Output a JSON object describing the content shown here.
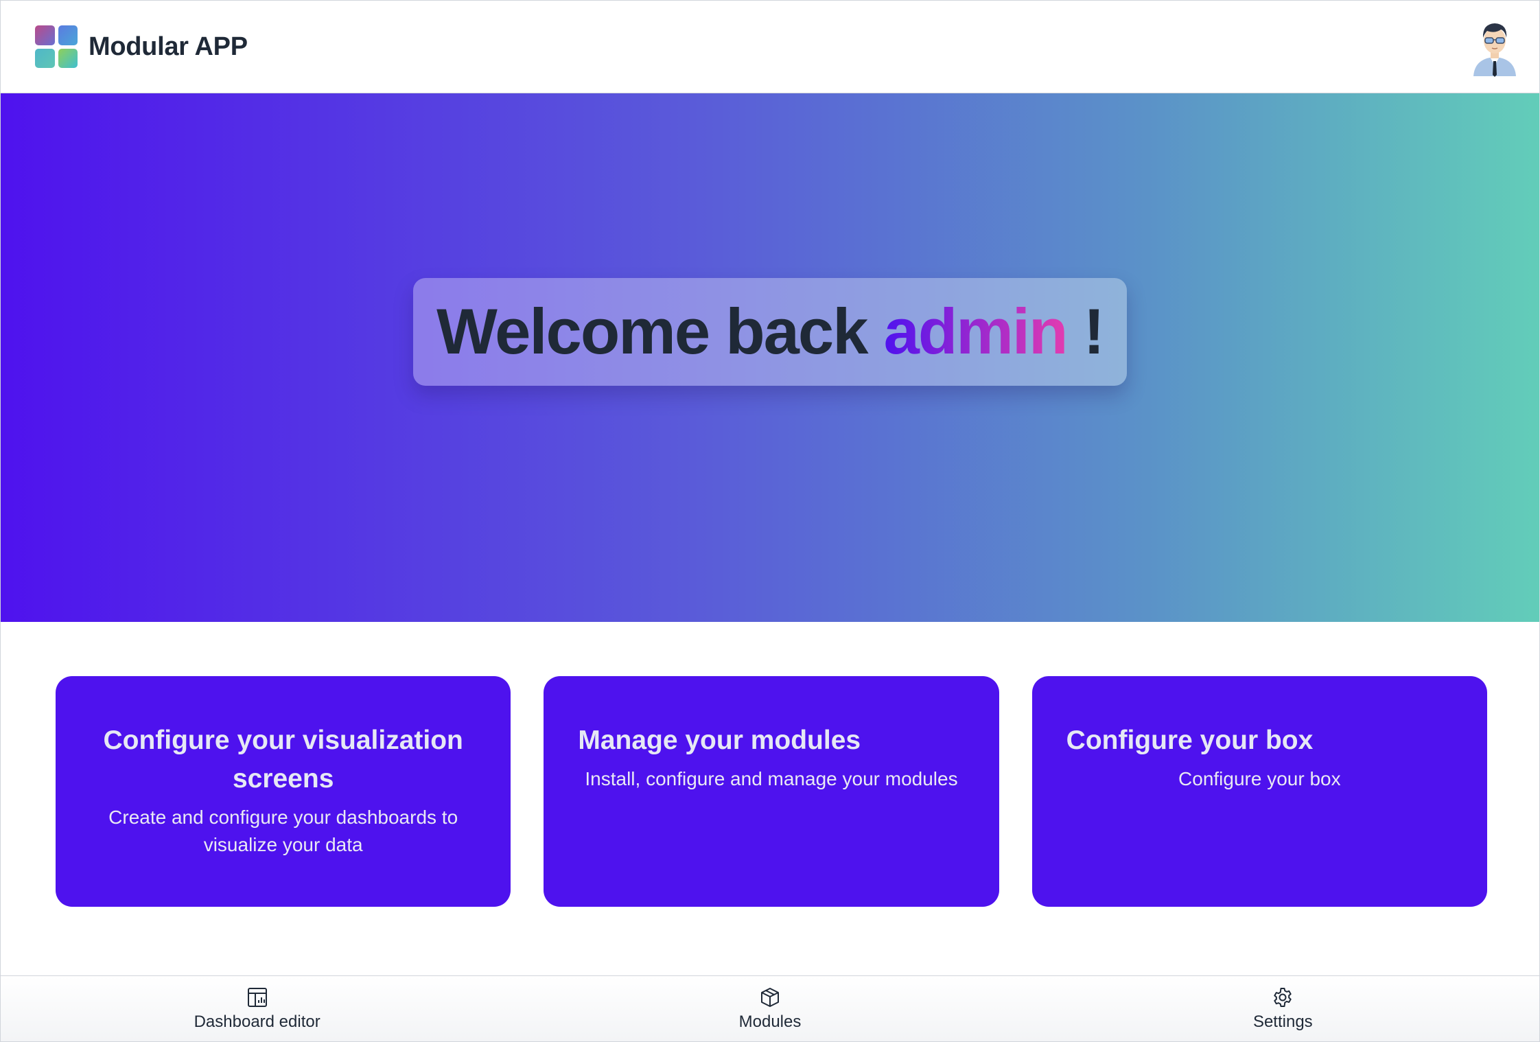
{
  "header": {
    "app_title": "Modular APP",
    "logo_icon": "app-grid-logo",
    "avatar_icon": "user-avatar"
  },
  "hero": {
    "welcome_prefix": "Welcome back",
    "username": "admin",
    "exclamation": "!"
  },
  "cards": [
    {
      "title": "Configure your visualization screens",
      "description": "Create and configure your dashboards to visualize your data"
    },
    {
      "title": "Manage your modules",
      "description": "Install, configure and manage your modules"
    },
    {
      "title": "Configure your box",
      "description": "Configure your box"
    }
  ],
  "bottom_nav": [
    {
      "label": "Dashboard editor",
      "icon": "dashboard-icon"
    },
    {
      "label": "Modules",
      "icon": "cube-icon"
    },
    {
      "label": "Settings",
      "icon": "gear-icon"
    }
  ],
  "colors": {
    "primary": "#4e12ee",
    "hero_gradient_start": "#4f12ee",
    "hero_gradient_end": "#62cdb9",
    "admin_gradient_end": "#e23cb0"
  }
}
